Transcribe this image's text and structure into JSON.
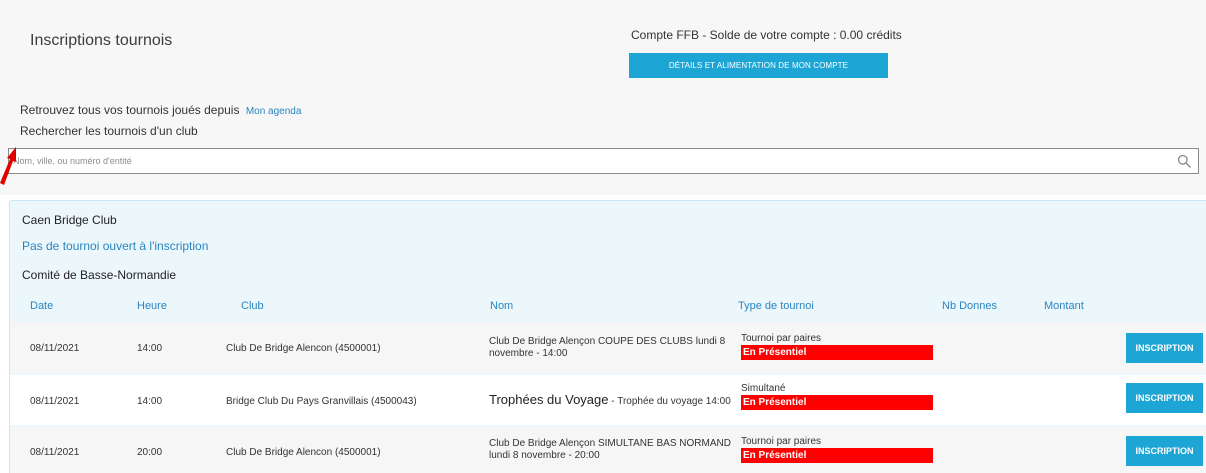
{
  "header": {
    "title": "Inscriptions tournois",
    "account_balance": "Compte FFB - Solde de votre compte : 0.00 crédits",
    "account_button": "DÉTAILS ET ALIMENTATION DE MON COMPTE"
  },
  "intro": {
    "text": "Retrouvez tous vos tournois joués depuis",
    "link": "Mon agenda",
    "search_label": "Rechercher les tournois d'un club"
  },
  "search": {
    "placeholder": "Nom, ville, ou numéro d'entité",
    "icon": "search-icon"
  },
  "club_panel": {
    "club_name": "Caen Bridge Club",
    "no_tournament": "Pas de tournoi ouvert à l'inscription",
    "comite_name": "Comité de Basse-Normandie"
  },
  "table": {
    "headers": {
      "date": "Date",
      "heure": "Heure",
      "club": "Club",
      "nom": "Nom",
      "type": "Type de tournoi",
      "nb_donnes": "Nb Donnes",
      "montant": "Montant"
    },
    "rows": [
      {
        "date": "08/11/2021",
        "heure": "14:00",
        "club": "Club De Bridge Alencon (4500001)",
        "nom": "Club De Bridge Alençon COUPE DES CLUBS lundi 8 novembre - 14:00",
        "nom_main": "",
        "nom_sub": "",
        "type": "Tournoi par paires",
        "badge": "En Présentiel",
        "button": "INSCRIPTION"
      },
      {
        "date": "08/11/2021",
        "heure": "14:00",
        "club": "Bridge Club Du Pays Granvillais (4500043)",
        "nom": "",
        "nom_main": "Trophées du Voyage",
        "nom_sub": " - Trophée du voyage 14:00",
        "type": "Simultané",
        "badge": "En Présentiel",
        "button": "INSCRIPTION"
      },
      {
        "date": "08/11/2021",
        "heure": "20:00",
        "club": "Club De Bridge Alencon (4500001)",
        "nom": "Club De Bridge Alençon SIMULTANE BAS NORMAND lundi 8 novembre - 20:00",
        "nom_main": "",
        "nom_sub": "",
        "type": "Tournoi par paires",
        "badge": "En Présentiel",
        "button": "INSCRIPTION"
      }
    ]
  },
  "colors": {
    "accent": "#1da5d6",
    "link": "#2a85c1",
    "badge": "#ff0000",
    "panel": "#ecf7fc"
  }
}
